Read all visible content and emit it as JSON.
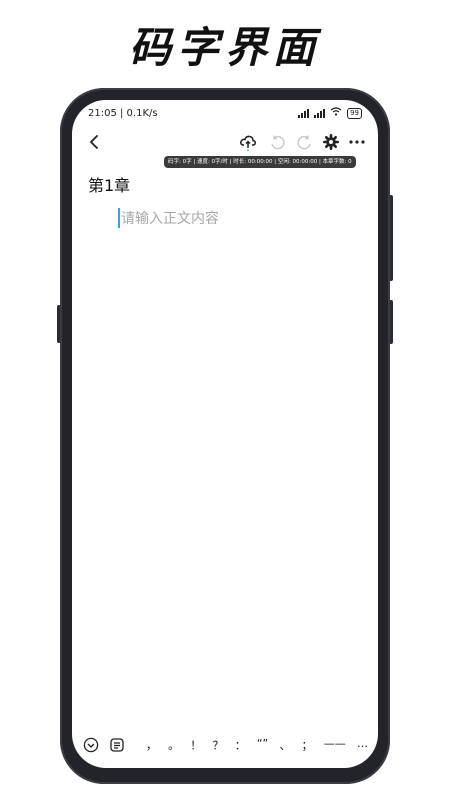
{
  "headline": "码字界面",
  "status_bar": {
    "time_speed": "21:05 | 0.1K/s",
    "battery": "99"
  },
  "toolbar": {
    "back_icon": "chevron-left-icon",
    "cloud_icon": "cloud-upload-icon",
    "undo_icon": "undo-icon",
    "redo_icon": "redo-icon",
    "settings_icon": "gear-icon",
    "more_icon": "more-icon"
  },
  "stats_bar": "码字: 0字 | 速度: 0字/时 | 时长: 00:00:00 | 空闲: 00:00:00 | 本章字数: 0",
  "editor": {
    "chapter_title": "第1章",
    "placeholder": "请输入正文内容"
  },
  "bottom_bar": {
    "collapse_icon": "chevron-down-circle-icon",
    "format_icon": "document-lines-icon",
    "punctuation": [
      "，",
      "。",
      "！",
      "？",
      "：",
      "“”",
      "、",
      "；",
      "——",
      "…"
    ]
  },
  "colors": {
    "accent": "#3aa0e6",
    "phone_frame": "#23242a",
    "placeholder": "#a7a7ab"
  }
}
